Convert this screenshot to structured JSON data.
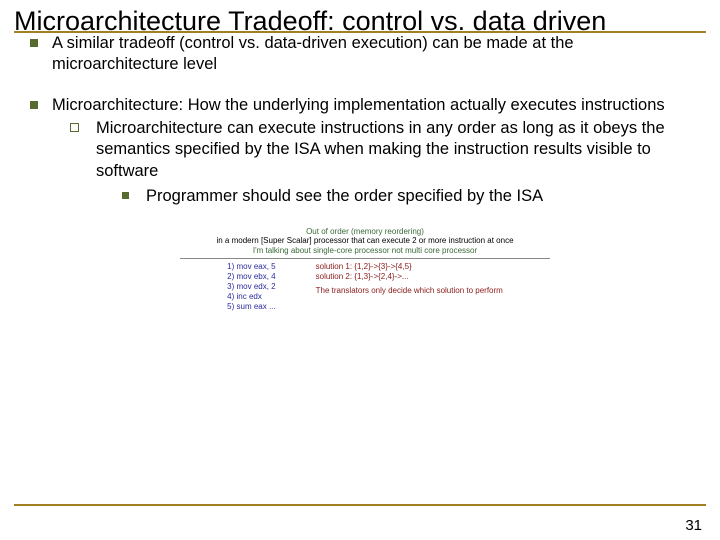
{
  "title": "Microarchitecture Tradeoff: control vs. data driven",
  "bullets": {
    "b1": "A similar tradeoff (control vs. data-driven execution) can be made at the microarchitecture level",
    "b2": "Microarchitecture: How the underlying implementation actually executes instructions",
    "b2_1": "Microarchitecture can execute instructions in any order as long as it obeys the semantics specified by the ISA when making the instruction results visible to software",
    "b2_1_1": "Programmer should see the order specified by the ISA"
  },
  "annotation": {
    "top_line1": "Out of order (memory reordering)",
    "top_line2": "in a modern [Super Scalar] processor that can execute 2 or more instruction at once",
    "top_line3": "I'm talking about single-core processor not multi core processor",
    "left_col": [
      "1) mov eax, 5",
      "2) mov ebx, 4",
      "3) mov edx, 2",
      "4) inc edx",
      "5) sum eax ..."
    ],
    "right_col": [
      "solution 1: {1,2}->{3}->{4,5}",
      "solution 2: {1,3}->{2,4}->...",
      "The translators only decide which solution to perform"
    ]
  },
  "page_number": "31"
}
